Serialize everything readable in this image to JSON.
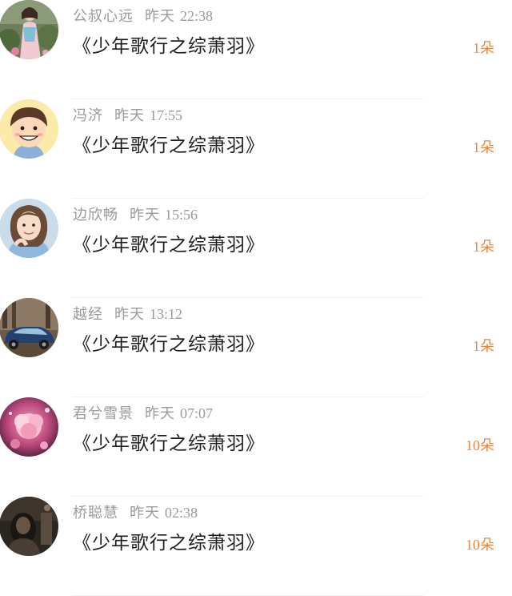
{
  "records": [
    {
      "name": "公叔心远",
      "day": "昨天",
      "time": "22:38",
      "gift": "《少年歌行之综萧羽》",
      "count": "1朵",
      "avatar": "woman-garden-avatar"
    },
    {
      "name": "冯济",
      "day": "昨天",
      "time": "17:55",
      "gift": "《少年歌行之综萧羽》",
      "count": "1朵",
      "avatar": "cartoon-boy-avatar"
    },
    {
      "name": "边欣畅",
      "day": "昨天",
      "time": "15:56",
      "gift": "《少年歌行之综萧羽》",
      "count": "1朵",
      "avatar": "girl-portrait-avatar"
    },
    {
      "name": "越经",
      "day": "昨天",
      "time": "13:12",
      "gift": "《少年歌行之综萧羽》",
      "count": "1朵",
      "avatar": "blue-car-avatar"
    },
    {
      "name": "君兮雪景",
      "day": "昨天",
      "time": "07:07",
      "gift": "《少年歌行之综萧羽》",
      "count": "10朵",
      "avatar": "pink-flower-avatar"
    },
    {
      "name": "桥聪慧",
      "day": "昨天",
      "time": "02:38",
      "gift": "《少年歌行之综萧羽》",
      "count": "10朵",
      "avatar": "dark-photo-avatar"
    }
  ],
  "colors": {
    "name": "#9a9a9a",
    "gift": "#1e1e1e",
    "count": "#e4873f",
    "divider": "#f1f1f1"
  }
}
